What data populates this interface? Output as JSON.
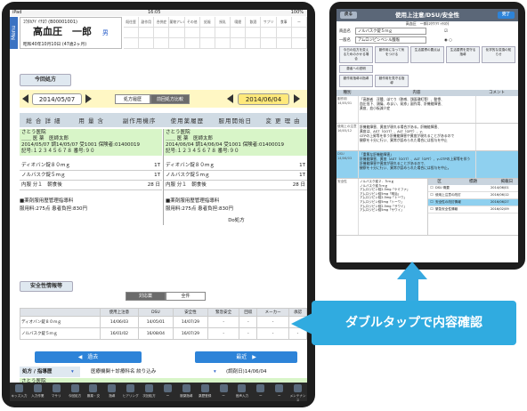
{
  "left": {
    "status": {
      "carrier": "iPad",
      "time": "16:05",
      "battery": "100%"
    },
    "menu_label": "Menu",
    "patient": {
      "id_line": "ｺｳﾀｶｱｲ ｲﾁﾛｳ (B00001001)",
      "name": "高血圧　一郎",
      "sex": "男",
      "dob": "昭和40年10月10日 (47歳2ヶ月)"
    },
    "top_grid": [
      "既往歴",
      "副作用",
      "合併症",
      "薬物アレルギー",
      "その他",
      "妊娠",
      "授乳",
      "喫煙",
      "飲酒",
      "サプリ",
      "食事",
      "ー"
    ],
    "current_rx": "今回処方",
    "date_left": "2014/05/07",
    "seg": [
      "処方履歴",
      "前回処方比較"
    ],
    "date_right": "2014/06/04",
    "col_headers": [
      "総 合 詳 細",
      "用 量 含",
      "副作用機序",
      "使用薬履歴",
      "服用開始日",
      "変 更 理 由"
    ],
    "rx_left": {
      "hosp": "さとう医院",
      "doc": "＿＿ 医 薬　医師太郎",
      "line1": "2014/05/07 調14/05/07 受1001 保険者:01400019",
      "line2": "記号:１２３４５６７８ 番号:９０",
      "items": [
        {
          "name": "ディオバン錠８０ｍｇ",
          "qty": "1T"
        },
        {
          "name": "ノルバスク錠５ｍｇ",
          "qty": "1T"
        },
        {
          "name": "内服 分１　朝食後",
          "qty": "28 日"
        }
      ],
      "note1": "■薬剤服用歴管理指導料",
      "note2": "服用料:275点 患者負担:830円"
    },
    "rx_right": {
      "hosp": "さとう医院",
      "doc": "＿＿ 医 薬　医師太郎",
      "line1": "2014/06/04 調14/06/04 受1001 保険者:01400019",
      "line2": "記号:１２３４５６７８ 番号:９０",
      "items": [
        {
          "name": "ディオバン錠８０ｍｇ",
          "qty": "1T"
        },
        {
          "name": "ノルバスク錠５ｍｇ",
          "qty": "1T"
        },
        {
          "name": "内服 分１　朝食後",
          "qty": "28 日"
        }
      ],
      "note1": "■薬剤服用歴管理指導料",
      "note2": "服用料:275点 患者負担:830円",
      "extra": "Do処方"
    },
    "safety_title": "安全性情報等",
    "safety_tabs": [
      "対応薬",
      "全件"
    ],
    "safety_headers": [
      "",
      "使用上注意",
      "DSU",
      "安全性",
      "緊急安全",
      "回収",
      "メーカー",
      "承認"
    ],
    "safety_rows": [
      [
        "ディオバン錠８０ｍｇ",
        "14/06/03",
        "14/05/01",
        "14/07/29",
        "-",
        "-",
        "-",
        "-"
      ],
      [
        "ノルバスク錠５ｍｇ",
        "16/01/02",
        "16/08/04",
        "16/07/29",
        "-",
        "-",
        "-",
        "-"
      ]
    ],
    "prev_btn": "◀　過去",
    "next_btn": "最近　▶",
    "filter": {
      "label": "処方 / 指導歴",
      "value": "医療機関＋診療科名 絞り込み",
      "date": "(調剤日)14/06/04"
    },
    "bottom_hosp": "さとう医院",
    "bottom_doc": "医薬　医師太郎",
    "dock": [
      "キッズ入力",
      "入力作業",
      "マサリ",
      "今回処方",
      "服薬・交",
      "指導",
      "ヒアリング",
      "次回処方",
      "ー",
      "服薬指導",
      "薬歴登録",
      "ー",
      "音声入力",
      "ー",
      "ー",
      "メンテナンス"
    ]
  },
  "right": {
    "title": "使用上注意/DSU/安全性",
    "back_btn": "戻る",
    "done_btn": "完了",
    "subtitle": "高血圧　一郎(ｺｳｹﾂｱﾂ ｲﾁﾛｳ)",
    "drug_label": "商品名",
    "drug_value": "ノルバスク錠５ｍｇ",
    "generic_label": "一般名",
    "generic_value": "アムロジピンベシル酸塩",
    "chips": [
      "今日の処方を変えるためのかかる場合",
      "副作用になって気をつける",
      "生活習慣の要点は",
      "生活習慣を見守る指導",
      "化学的な変換の知らせ",
      "患者への説明"
    ],
    "chips2": [
      "副作用指導の指導",
      "副作用を見守る指導"
    ],
    "headers": [
      "種別",
      "内容",
      "コメント"
    ],
    "rows": [
      {
        "type": "副作用",
        "date": "14/05/01",
        "text": "「高齢者　浮腫、ほてり（熱感、顔面潮紅等）、動悸、\n血圧低下、頭痛、めまい、発疹」副作用、肝機能障害、\n黄疸、血小板減少症",
        "blue": false
      },
      {
        "type": "使用上の注意",
        "date": "16/05/12",
        "text": "肝機能障害、黄疸が現れる場合がある。肝機能障害、\n黄疸は、AST（GOT）、ALT（GPT）、γ-\nGTPの上昇等を伴う肝機能障害や黄疸が現れることがあるので\n観察を十分に行い、異常が認められた場合には投与を中止",
        "blue": false
      },
      {
        "type": "DSU",
        "date": "14/06/03",
        "text": "「重篤な肝機能障害」\n肝機能障害、黄疸（AST（GOT）、ALT（GPT）、γ-GTPの上昇等を伴う\n肝機能障害や黄疸が現れることがあるので、\n観察を十分に行い、異常が認められた場合には投与を中止。",
        "blue": true
      }
    ],
    "lower_type": "安全性",
    "lower_text": "ノルバスク錠２．５ｍｇ\nノルバスク錠５ｍｇ\nアムロジピン錠2.5mg「ケミファ」\nアムロジピン錠5mg「明治」\nアムロジピン錠2.5mg「トーワ」\nアムロジピン錠5mg「トーワ」\nアムロジピン錠2.5mg「サワイ」\nアムロジピン錠5mg「サワイ」",
    "lower_headers": [
      "区",
      "標題",
      "掲載日"
    ],
    "lower_rows": [
      {
        "title": "DSU 概要",
        "date": "2014/06/01",
        "sel": false
      },
      {
        "title": "使用上注意の改訂",
        "date": "2016/06/12",
        "sel": false
      },
      {
        "title": "安全性の改訂情報",
        "date": "2016/06/27",
        "sel": true
      },
      {
        "title": "緊急安全性情報",
        "date": "2016/02/09",
        "sel": false
      }
    ]
  },
  "callout": "ダブルタップで内容確認"
}
